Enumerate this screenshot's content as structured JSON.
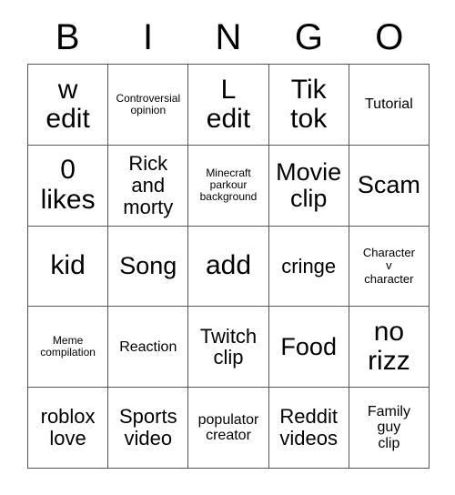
{
  "card": {
    "headers": [
      "B",
      "I",
      "N",
      "G",
      "O"
    ],
    "rows": [
      [
        {
          "text": "w\nedit",
          "size": "fs-xl"
        },
        {
          "text": "Controversial\nopinion",
          "size": "fs-xxs"
        },
        {
          "text": "L\nedit",
          "size": "fs-xl"
        },
        {
          "text": "Tik\ntok",
          "size": "fs-xl"
        },
        {
          "text": "Tutorial",
          "size": "fs-sm"
        }
      ],
      [
        {
          "text": "0\nlikes",
          "size": "fs-xl"
        },
        {
          "text": "Rick\nand\nmorty",
          "size": "fs-md"
        },
        {
          "text": "Minecraft\nparkour\nbackground",
          "size": "fs-xxs"
        },
        {
          "text": "Movie\nclip",
          "size": "fs-lg"
        },
        {
          "text": "Scam",
          "size": "fs-lg"
        }
      ],
      [
        {
          "text": "kid",
          "size": "fs-xl"
        },
        {
          "text": "Song",
          "size": "fs-lg"
        },
        {
          "text": "add",
          "size": "fs-xl"
        },
        {
          "text": "cringe",
          "size": "fs-md"
        },
        {
          "text": "Character\nv\ncharacter",
          "size": "fs-xs"
        }
      ],
      [
        {
          "text": "Meme\ncompilation",
          "size": "fs-xxs"
        },
        {
          "text": "Reaction",
          "size": "fs-sm"
        },
        {
          "text": "Twitch\nclip",
          "size": "fs-md"
        },
        {
          "text": "Food",
          "size": "fs-lg"
        },
        {
          "text": "no\nrizz",
          "size": "fs-xl"
        }
      ],
      [
        {
          "text": "roblox\nlove",
          "size": "fs-md"
        },
        {
          "text": "Sports\nvideo",
          "size": "fs-md"
        },
        {
          "text": "populator\ncreator",
          "size": "fs-sm"
        },
        {
          "text": "Reddit\nvideos",
          "size": "fs-md"
        },
        {
          "text": "Family\nguy\nclip",
          "size": "fs-sm"
        }
      ]
    ]
  },
  "colors": {
    "background": "#ffffff",
    "grid_line": "#555555",
    "text": "#000000"
  }
}
